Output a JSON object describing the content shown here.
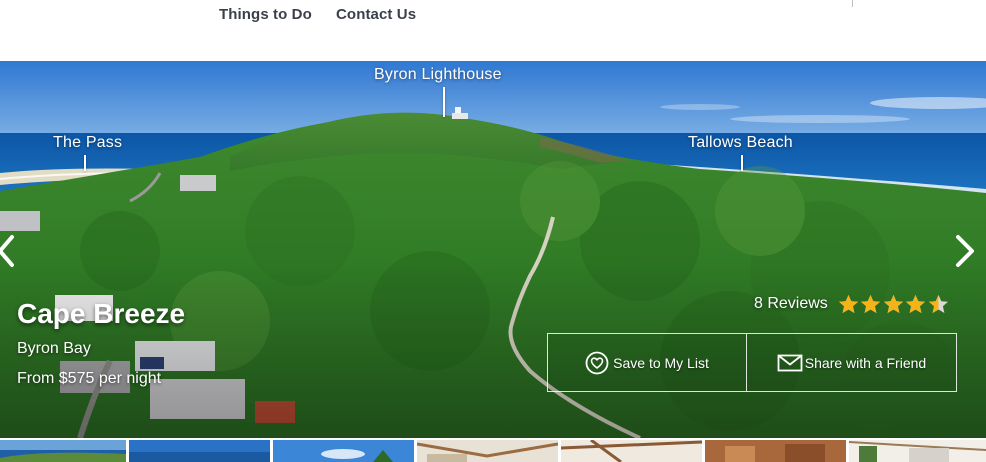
{
  "nav": {
    "things_to_do": "Things to Do",
    "contact_us": "Contact Us"
  },
  "hero": {
    "landmarks": {
      "lighthouse": "Byron Lighthouse",
      "pass": "The Pass",
      "tallows": "Tallows Beach"
    },
    "property": {
      "name": "Cape Breeze",
      "location": "Byron Bay",
      "price": "From $575 per night"
    },
    "reviews": {
      "label": "8 Reviews",
      "rating": 4.5,
      "max": 5,
      "star_color": "#f5b31a"
    },
    "actions": {
      "save": "Save to My List",
      "share": "Share with a Friend"
    },
    "icons": {
      "prev": "chevron-left-icon",
      "next": "chevron-right-icon",
      "save": "heart-icon",
      "share": "envelope-icon"
    }
  },
  "thumbnails": [
    {
      "subject": "coastline aerial"
    },
    {
      "subject": "sky and sea"
    },
    {
      "subject": "sky and palms"
    },
    {
      "subject": "interior ceiling"
    },
    {
      "subject": "interior beams"
    },
    {
      "subject": "timber interior"
    },
    {
      "subject": "living room"
    }
  ]
}
